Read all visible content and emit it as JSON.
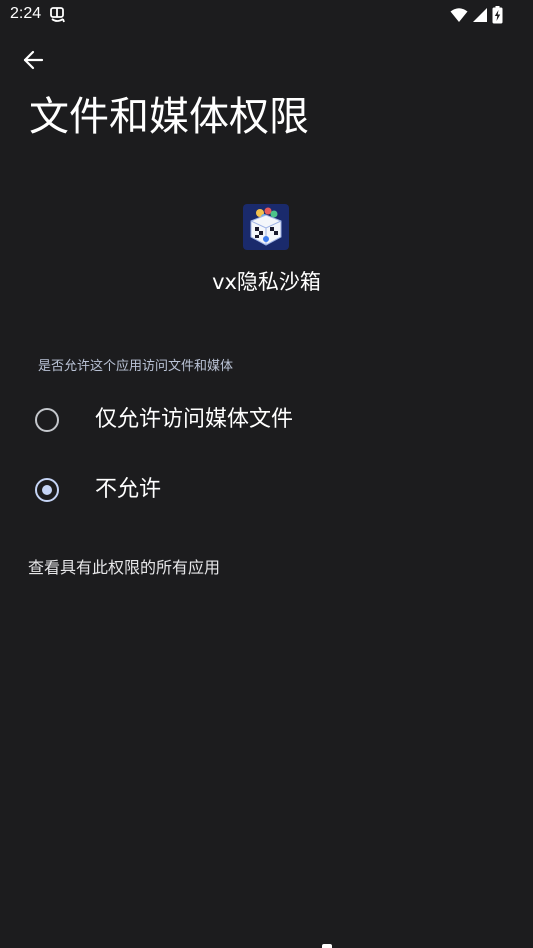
{
  "status_bar": {
    "time": "2:24"
  },
  "header": {
    "title": "文件和媒体权限"
  },
  "app": {
    "name": "vx隐私沙箱"
  },
  "permission": {
    "section_title": "是否允许这个应用访问文件和媒体",
    "options": [
      {
        "label": "仅允许访问媒体文件",
        "selected": false
      },
      {
        "label": "不允许",
        "selected": true
      }
    ]
  },
  "footer": {
    "view_all_label": "查看具有此权限的所有应用"
  },
  "colors": {
    "background": "#1c1c1e",
    "accent": "#c5d4f5",
    "text": "#ffffff"
  }
}
